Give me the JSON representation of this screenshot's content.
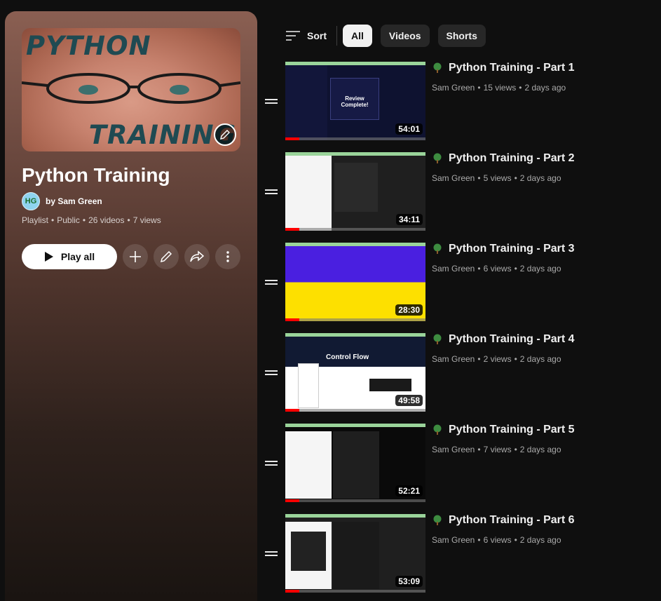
{
  "playlist": {
    "hero_top_word": "PYTHON",
    "hero_bottom_word": "TRAINING",
    "title": "Python Training",
    "owner": "by Sam Green",
    "owner_avatar_text": "HG",
    "meta": [
      "Playlist",
      "Public",
      "26 videos",
      "7 views"
    ],
    "play_all_label": "Play all",
    "accent_color": "#ffffff"
  },
  "filters": {
    "sort_label": "Sort",
    "chips": [
      "All",
      "Videos",
      "Shorts"
    ],
    "active": "All"
  },
  "videos": [
    {
      "title": "Python Training - Part 1",
      "channel": "Sam Green",
      "views": "15 views",
      "age": "2 days ago",
      "duration": "54:01",
      "watched_fraction": 0.1
    },
    {
      "title": "Python Training - Part 2",
      "channel": "Sam Green",
      "views": "5 views",
      "age": "2 days ago",
      "duration": "34:11",
      "watched_fraction": 0.1
    },
    {
      "title": "Python Training - Part 3",
      "channel": "Sam Green",
      "views": "6 views",
      "age": "2 days ago",
      "duration": "28:30",
      "watched_fraction": 0.1
    },
    {
      "title": "Python Training - Part 4",
      "channel": "Sam Green",
      "views": "2 views",
      "age": "2 days ago",
      "duration": "49:58",
      "watched_fraction": 0.1
    },
    {
      "title": "Python Training - Part 5",
      "channel": "Sam Green",
      "views": "7 views",
      "age": "2 days ago",
      "duration": "52:21",
      "watched_fraction": 0.1
    },
    {
      "title": "Python Training - Part 6",
      "channel": "Sam Green",
      "views": "6 views",
      "age": "2 days ago",
      "duration": "53:09",
      "watched_fraction": 0.1
    }
  ],
  "thumb_texts": {
    "review": "Review Complete!",
    "control_flow": "Control Flow"
  },
  "icons": {
    "sort": "sort-lines-icon",
    "play": "play-triangle-icon",
    "add": "plus-icon",
    "edit": "pencil-icon",
    "share": "share-arrow-icon",
    "more": "vertical-dots-icon",
    "drag": "drag-handle-icon",
    "tree": "tree-icon"
  }
}
